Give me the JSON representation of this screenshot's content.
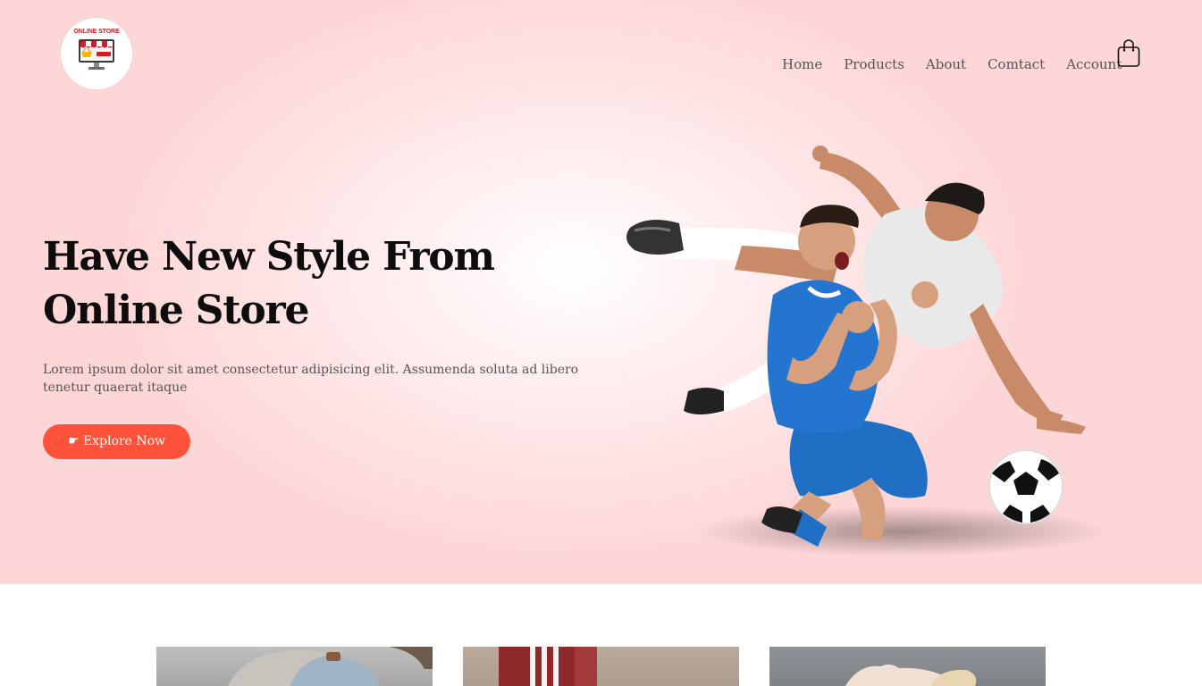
{
  "brand": {
    "logo_text": "ONLINE STORE",
    "accent_color": "#ff523b",
    "logo_red": "#d11f2a"
  },
  "nav": {
    "items": [
      {
        "label": "Home"
      },
      {
        "label": "Products"
      },
      {
        "label": "About"
      },
      {
        "label": "Comtact"
      },
      {
        "label": "Account"
      }
    ],
    "cart_icon": "shopping-bag-icon"
  },
  "hero": {
    "title": "Have New Style From Online Store",
    "subtitle": "Lorem ipsum dolor sit amet consectetur adipisicing elit. Assumenda soluta ad libero tenetur quaerat itaque",
    "cta_label": "☛ Explore Now",
    "image_description_icon": "soccer-players-image"
  },
  "products": {
    "cards": [
      {
        "image": "product-image-1"
      },
      {
        "image": "product-image-2"
      },
      {
        "image": "product-image-3"
      }
    ]
  }
}
